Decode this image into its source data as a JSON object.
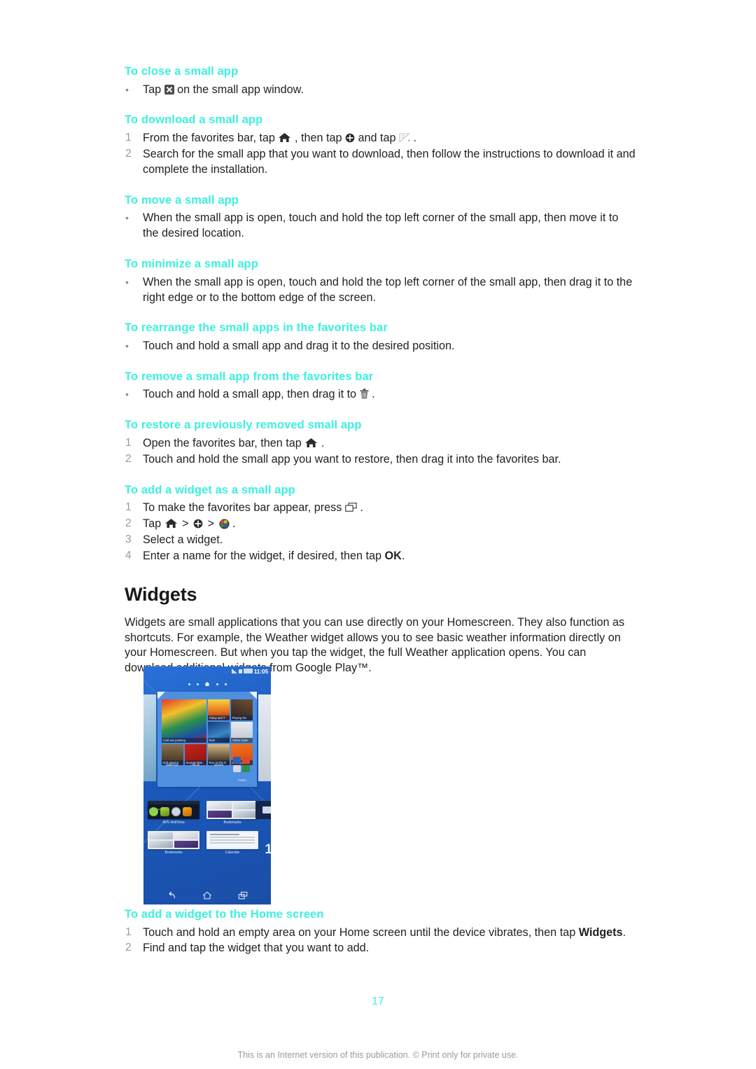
{
  "document": {
    "page_number": "17",
    "footer_note": "This is an Internet version of this publication. © Print only for private use."
  },
  "colors": {
    "heading_cyan": "#3df0df",
    "body_text": "#231f20",
    "marker_gray": "#9a9a9a",
    "phone_blue": "#1d62c6"
  },
  "sections": [
    {
      "heading": "To close a small app",
      "list_type": "bullet",
      "items": [
        {
          "pre": "Tap",
          "icon": "close-icon",
          "post": "on the small app window."
        }
      ]
    },
    {
      "heading": "To download a small app",
      "list_type": "number",
      "items": [
        {
          "pre": "From the favorites bar, tap",
          "icon": "home-icon",
          "mid": ", then tap",
          "icon2": "plus-circle-icon",
          "mid2": "and tap",
          "icon3": "get-more-small-apps-icon",
          "post": "."
        },
        {
          "text": "Search for the small app that you want to download, then follow the instructions to download it and complete the installation."
        }
      ]
    },
    {
      "heading": "To move a small app",
      "list_type": "bullet",
      "items": [
        {
          "text": "When the small app is open, touch and hold the top left corner of the small app, then move it to the desired location."
        }
      ]
    },
    {
      "heading": "To minimize a small app",
      "list_type": "bullet",
      "items": [
        {
          "text": "When the small app is open, touch and hold the top left corner of the small app, then drag it to the right edge or to the bottom edge of the screen."
        }
      ]
    },
    {
      "heading": "To rearrange the small apps in the favorites bar",
      "list_type": "bullet",
      "items": [
        {
          "text": "Touch and hold a small app and drag it to the desired position."
        }
      ]
    },
    {
      "heading": "To remove a small app from the favorites bar",
      "list_type": "bullet",
      "items": [
        {
          "pre": "Touch and hold a small app, then drag it to",
          "icon": "trash-icon",
          "post": "."
        }
      ]
    },
    {
      "heading": "To restore a previously removed small app",
      "list_type": "number",
      "items": [
        {
          "pre": "Open the favorites bar, then tap",
          "icon": "home-icon",
          "post": "."
        },
        {
          "text": "Touch and hold the small app you want to restore, then drag it into the favorites bar."
        }
      ]
    },
    {
      "heading": "To add a widget as a small app",
      "list_type": "number",
      "items": [
        {
          "pre": "To make the favorites bar appear, press",
          "icon": "recent-apps-icon",
          "post": "."
        },
        {
          "pre": "Tap",
          "icon": "home-icon",
          "sep1": ">",
          "icon2": "plus-circle-icon",
          "sep2": ">",
          "icon3": "widget-ball-icon",
          "post": "."
        },
        {
          "text": "Select a widget."
        },
        {
          "pre_bold": "Enter a name for the widget, if desired, then tap",
          "bold": "OK",
          "post": "."
        }
      ]
    }
  ],
  "widgets_section": {
    "title": "Widgets",
    "paragraph": "Widgets are small applications that you can use directly on your Homescreen. They also function as shortcuts. For example, the Weather widget allows you to see basic weather information directly on your Homescreen. But when you tap the widget, the full Weather application opens. You can download additional widgets from Google Play™."
  },
  "phone_figure": {
    "alt": "Android home screen widget picker",
    "status_bar": {
      "time": "11:05"
    },
    "music_tiles": [
      {
        "label": "Cold war painting"
      },
      {
        "label": "Mnus"
      },
      {
        "label": "Today and T"
      },
      {
        "label": "Playing the"
      },
      {
        "label": "Rain"
      },
      {
        "label": "Yellow Diam"
      },
      {
        "label": "Kids playing"
      },
      {
        "label": "Sounds likes"
      },
      {
        "label": "Run on the D"
      },
      {
        "label": "Walkround"
      }
    ],
    "app_shortcuts": [
      {
        "label": "Walkman"
      },
      {
        "label": "Album"
      },
      {
        "label": "Movies"
      },
      {
        "label": "Folder"
      }
    ],
    "widget_choices": [
      {
        "label": "AVG AntiVirus"
      },
      {
        "label": "Bookmarks"
      },
      {
        "label": "Bookmarks"
      },
      {
        "label": "Calendar"
      }
    ],
    "counter": "1",
    "nav": [
      {
        "name": "back-button"
      },
      {
        "name": "home-button"
      },
      {
        "name": "recents-button"
      }
    ]
  },
  "final_section": {
    "heading": "To add a widget to the Home screen",
    "items": [
      {
        "pre_bold": "Touch and hold an empty area on your Home screen until the device vibrates, then tap",
        "bold": "Widgets",
        "post": "."
      },
      {
        "text": "Find and tap the widget that you want to add."
      }
    ]
  }
}
